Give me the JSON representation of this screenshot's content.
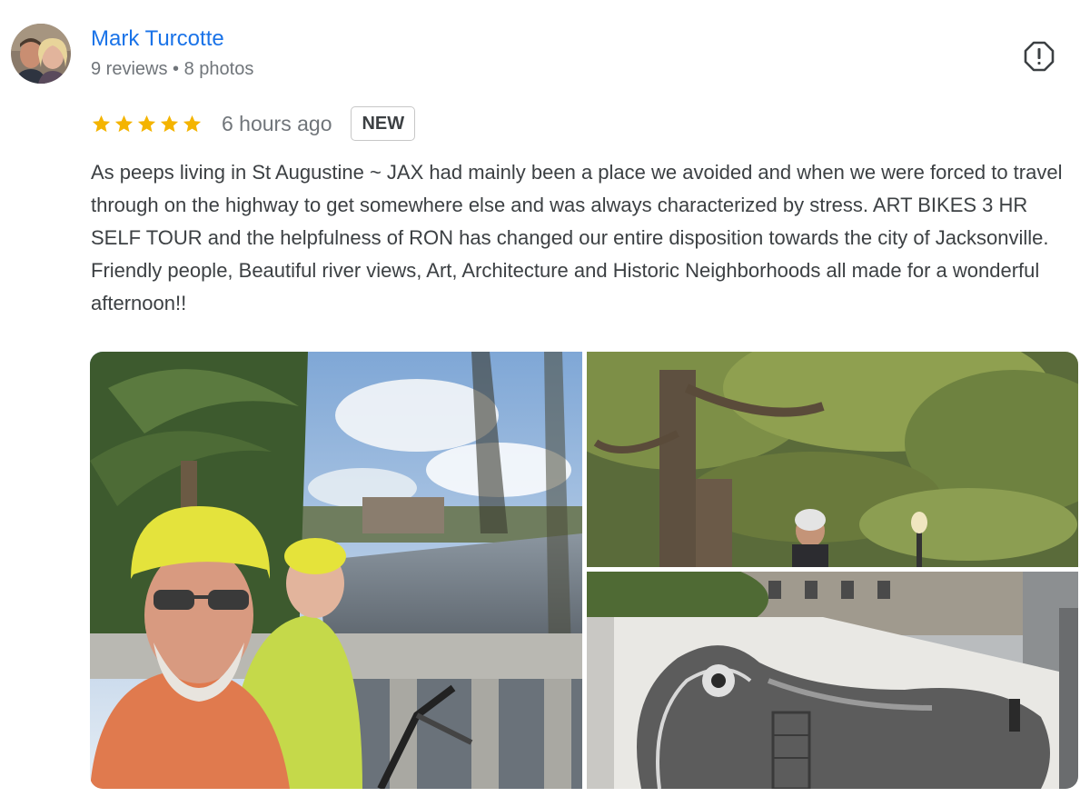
{
  "reviewer": {
    "name": "Mark Turcotte",
    "meta": "9 reviews • 8 photos"
  },
  "review": {
    "rating": 5,
    "max_rating": 5,
    "time_ago": "6 hours ago",
    "badge": "NEW",
    "text": "As peeps living in St Augustine ~ JAX had mainly been a place we avoided and when we were forced to travel through on the highway to get somewhere else and was always characterized by stress. ART BIKES 3 HR SELF TOUR and the helpfulness of RON has changed our entire disposition towards the city of Jacksonville. Friendly people, Beautiful river views, Art, Architecture and Historic Neighborhoods all made for a wonderful afternoon!!"
  },
  "icons": {
    "report": "report-flag-icon",
    "star": "star-icon"
  },
  "colors": {
    "name_link": "#1a73e8",
    "star": "#f4b400",
    "meta_text": "#70757a",
    "body_text": "#3c4043"
  }
}
